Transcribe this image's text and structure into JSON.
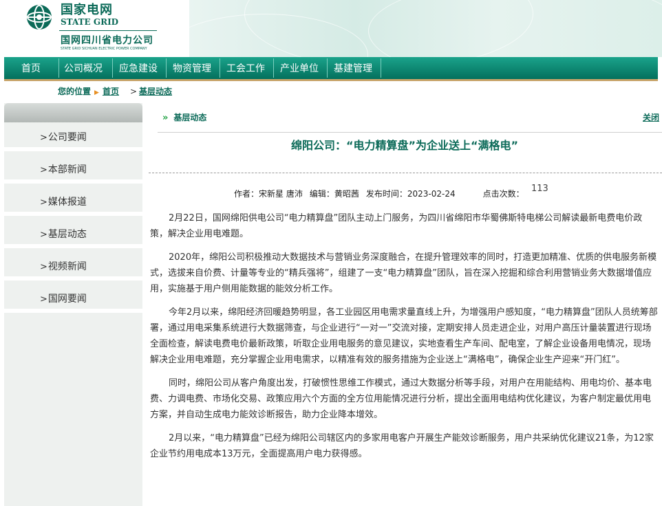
{
  "header": {
    "logo_cn": "国家电网",
    "logo_en": "STATE GRID",
    "company_cn": "国网四川省电力公司",
    "company_en": "STATE GRID SICHUAN ELECTRIC POWER COMPANY",
    "brand_color": "#0b6a58"
  },
  "nav": {
    "items": [
      "首页",
      "公司概况",
      "应急建设",
      "物资管理",
      "工会工作",
      "产业单位",
      "基建管理"
    ]
  },
  "breadcrumb": {
    "label": "您的位置",
    "home": "首页",
    "current": "基层动态"
  },
  "sidebar": {
    "items": [
      "公司要闻",
      "本部新闻",
      "媒体报道",
      "基层动态",
      "视频新闻",
      "国网要闻"
    ]
  },
  "article": {
    "column": "基层动态",
    "close": "关闭",
    "title": "绵阳公司：“电力精算盘”为企业送上“满格电”",
    "author": "作者：宋新星 唐沛",
    "editor": "编辑：黄昭茜",
    "publish_time": "发布时间：2023-02-24",
    "hits_label": "点击次数：",
    "hits": "113",
    "paragraphs": [
      "2月22日，国网绵阳供电公司“电力精算盘”团队主动上门服务，为四川省绵阳市华蜀佛斯特电梯公司解读最新电费电价政策，解决企业用电难题。",
      "2020年，绵阳公司积极推动大数据技术与营销业务深度融合，在提升管理效率的同时，打造更加精准、优质的供电服务新模式，选拔来自价费、计量等专业的“精兵强将”，组建了一支“电力精算盘”团队，旨在深入挖掘和综合利用营销业务大数据增值应用，实施基于用户侧用能数据的能效分析工作。",
      "今年2月以来，绵阳经济回暖趋势明显，各工业园区用电需求量直线上升，为增强用户感知度，“电力精算盘”团队人员统筹部署，通过用电采集系统进行大数据筛查，与企业进行“一对一”交流对接，定期安排人员走进企业，对用户高压计量装置进行现场全面检查，解读电费电价最新政策，听取企业用电服务的意见建议，实地查看生产车间、配电室，了解企业设备用电情况，现场解决企业用电难题，充分掌握企业用电需求，以精准有效的服务措施为企业送上“满格电”，确保企业生产迎来“开门红”。",
      "同时，绵阳公司从客户角度出发，打破惯性思维工作模式，通过大数据分析等手段，对用户在用能结构、用电均价、基本电费、力调电费、市场化交易、政策应用六个方面的全方位用能情况进行分析，提出全面用电结构优化建议，为客户制定最优用电方案，并自动生成电力能效诊断报告，助力企业降本增效。",
      "2月以来，“电力精算盘”已经为绵阳公司辖区内的多家用电客户开展生产能效诊断服务，用户共采纳优化建议21条，为12家企业节约用电成本13万元，全面提高用户电力获得感。"
    ]
  }
}
